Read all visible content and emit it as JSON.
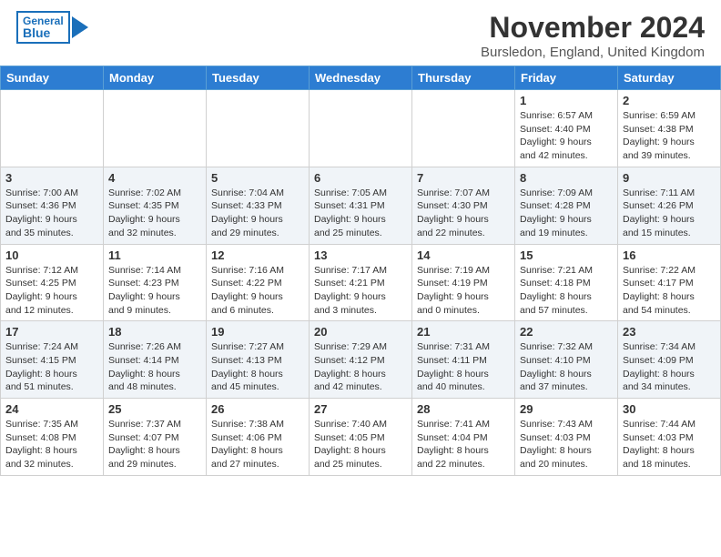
{
  "header": {
    "logo_general": "General",
    "logo_blue": "Blue",
    "title": "November 2024",
    "subtitle": "Bursledon, England, United Kingdom"
  },
  "days_of_week": [
    "Sunday",
    "Monday",
    "Tuesday",
    "Wednesday",
    "Thursday",
    "Friday",
    "Saturday"
  ],
  "weeks": [
    [
      {
        "day": "",
        "info": ""
      },
      {
        "day": "",
        "info": ""
      },
      {
        "day": "",
        "info": ""
      },
      {
        "day": "",
        "info": ""
      },
      {
        "day": "",
        "info": ""
      },
      {
        "day": "1",
        "info": "Sunrise: 6:57 AM\nSunset: 4:40 PM\nDaylight: 9 hours\nand 42 minutes."
      },
      {
        "day": "2",
        "info": "Sunrise: 6:59 AM\nSunset: 4:38 PM\nDaylight: 9 hours\nand 39 minutes."
      }
    ],
    [
      {
        "day": "3",
        "info": "Sunrise: 7:00 AM\nSunset: 4:36 PM\nDaylight: 9 hours\nand 35 minutes."
      },
      {
        "day": "4",
        "info": "Sunrise: 7:02 AM\nSunset: 4:35 PM\nDaylight: 9 hours\nand 32 minutes."
      },
      {
        "day": "5",
        "info": "Sunrise: 7:04 AM\nSunset: 4:33 PM\nDaylight: 9 hours\nand 29 minutes."
      },
      {
        "day": "6",
        "info": "Sunrise: 7:05 AM\nSunset: 4:31 PM\nDaylight: 9 hours\nand 25 minutes."
      },
      {
        "day": "7",
        "info": "Sunrise: 7:07 AM\nSunset: 4:30 PM\nDaylight: 9 hours\nand 22 minutes."
      },
      {
        "day": "8",
        "info": "Sunrise: 7:09 AM\nSunset: 4:28 PM\nDaylight: 9 hours\nand 19 minutes."
      },
      {
        "day": "9",
        "info": "Sunrise: 7:11 AM\nSunset: 4:26 PM\nDaylight: 9 hours\nand 15 minutes."
      }
    ],
    [
      {
        "day": "10",
        "info": "Sunrise: 7:12 AM\nSunset: 4:25 PM\nDaylight: 9 hours\nand 12 minutes."
      },
      {
        "day": "11",
        "info": "Sunrise: 7:14 AM\nSunset: 4:23 PM\nDaylight: 9 hours\nand 9 minutes."
      },
      {
        "day": "12",
        "info": "Sunrise: 7:16 AM\nSunset: 4:22 PM\nDaylight: 9 hours\nand 6 minutes."
      },
      {
        "day": "13",
        "info": "Sunrise: 7:17 AM\nSunset: 4:21 PM\nDaylight: 9 hours\nand 3 minutes."
      },
      {
        "day": "14",
        "info": "Sunrise: 7:19 AM\nSunset: 4:19 PM\nDaylight: 9 hours\nand 0 minutes."
      },
      {
        "day": "15",
        "info": "Sunrise: 7:21 AM\nSunset: 4:18 PM\nDaylight: 8 hours\nand 57 minutes."
      },
      {
        "day": "16",
        "info": "Sunrise: 7:22 AM\nSunset: 4:17 PM\nDaylight: 8 hours\nand 54 minutes."
      }
    ],
    [
      {
        "day": "17",
        "info": "Sunrise: 7:24 AM\nSunset: 4:15 PM\nDaylight: 8 hours\nand 51 minutes."
      },
      {
        "day": "18",
        "info": "Sunrise: 7:26 AM\nSunset: 4:14 PM\nDaylight: 8 hours\nand 48 minutes."
      },
      {
        "day": "19",
        "info": "Sunrise: 7:27 AM\nSunset: 4:13 PM\nDaylight: 8 hours\nand 45 minutes."
      },
      {
        "day": "20",
        "info": "Sunrise: 7:29 AM\nSunset: 4:12 PM\nDaylight: 8 hours\nand 42 minutes."
      },
      {
        "day": "21",
        "info": "Sunrise: 7:31 AM\nSunset: 4:11 PM\nDaylight: 8 hours\nand 40 minutes."
      },
      {
        "day": "22",
        "info": "Sunrise: 7:32 AM\nSunset: 4:10 PM\nDaylight: 8 hours\nand 37 minutes."
      },
      {
        "day": "23",
        "info": "Sunrise: 7:34 AM\nSunset: 4:09 PM\nDaylight: 8 hours\nand 34 minutes."
      }
    ],
    [
      {
        "day": "24",
        "info": "Sunrise: 7:35 AM\nSunset: 4:08 PM\nDaylight: 8 hours\nand 32 minutes."
      },
      {
        "day": "25",
        "info": "Sunrise: 7:37 AM\nSunset: 4:07 PM\nDaylight: 8 hours\nand 29 minutes."
      },
      {
        "day": "26",
        "info": "Sunrise: 7:38 AM\nSunset: 4:06 PM\nDaylight: 8 hours\nand 27 minutes."
      },
      {
        "day": "27",
        "info": "Sunrise: 7:40 AM\nSunset: 4:05 PM\nDaylight: 8 hours\nand 25 minutes."
      },
      {
        "day": "28",
        "info": "Sunrise: 7:41 AM\nSunset: 4:04 PM\nDaylight: 8 hours\nand 22 minutes."
      },
      {
        "day": "29",
        "info": "Sunrise: 7:43 AM\nSunset: 4:03 PM\nDaylight: 8 hours\nand 20 minutes."
      },
      {
        "day": "30",
        "info": "Sunrise: 7:44 AM\nSunset: 4:03 PM\nDaylight: 8 hours\nand 18 minutes."
      }
    ]
  ]
}
